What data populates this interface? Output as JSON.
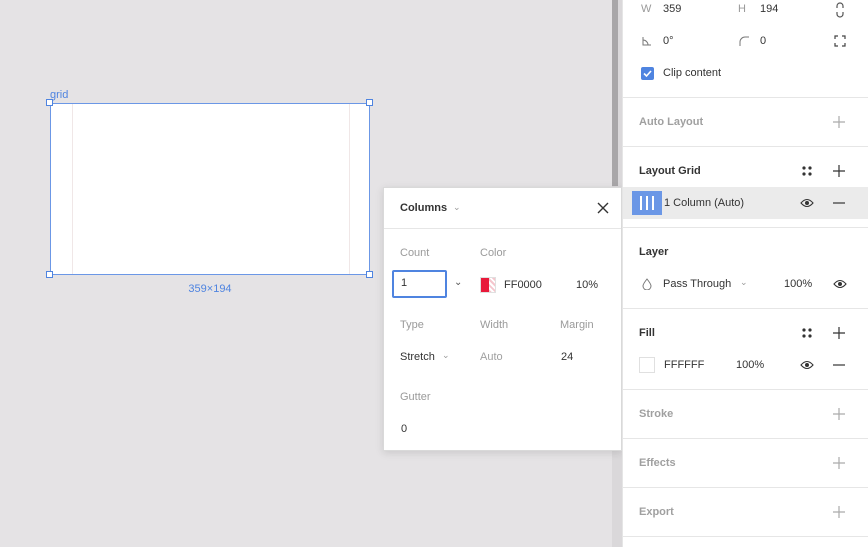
{
  "canvas": {
    "frame_name": "grid",
    "frame_size": "359×194"
  },
  "popover": {
    "title": "Columns",
    "count_label": "Count",
    "count_value": "1",
    "color_label": "Color",
    "color_hex": "FF0000",
    "color_opacity": "10%",
    "type_label": "Type",
    "type_value": "Stretch",
    "width_label": "Width",
    "width_value": "Auto",
    "margin_label": "Margin",
    "margin_value": "24",
    "gutter_label": "Gutter",
    "gutter_value": "0"
  },
  "panel": {
    "w_label": "W",
    "w_value": "359",
    "h_label": "H",
    "h_value": "194",
    "rotation_value": "0°",
    "radius_value": "0",
    "clip_content_label": "Clip content",
    "clip_content_checked": true,
    "auto_layout_title": "Auto Layout",
    "layout_grid_title": "Layout Grid",
    "layout_grid_item": "1 Column (Auto)",
    "layer_title": "Layer",
    "blend_mode": "Pass Through",
    "layer_opacity": "100%",
    "fill_title": "Fill",
    "fill_hex": "FFFFFF",
    "fill_opacity": "100%",
    "stroke_title": "Stroke",
    "effects_title": "Effects",
    "export_title": "Export"
  },
  "colors": {
    "accent": "#4f84e0",
    "grid_color": "#ff0000",
    "canvas_bg": "#e5e3e5"
  }
}
